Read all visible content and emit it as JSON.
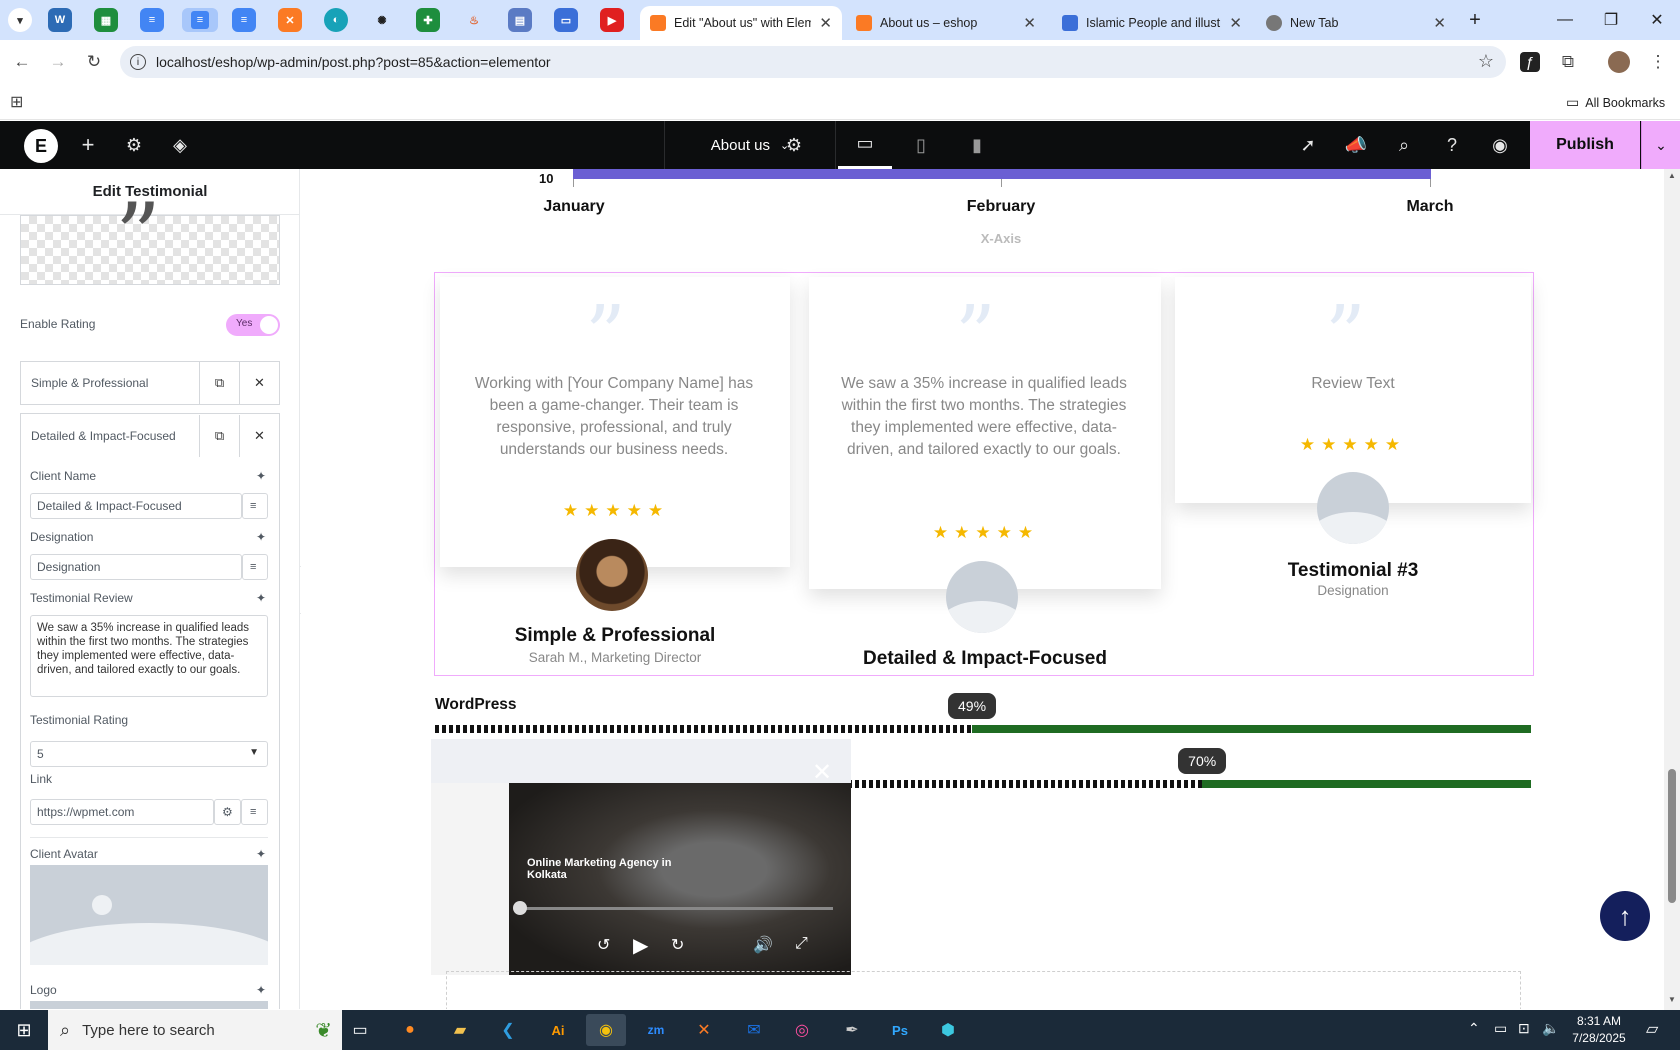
{
  "browser": {
    "pinned_tabs": [
      "WordPress",
      "Sheets",
      "Docs",
      "Docs",
      "Docs",
      "XAMPP",
      "Site",
      "ChatGPT",
      "Sheets",
      "App",
      "Tool",
      "Forms",
      "YouTube"
    ],
    "tabs": [
      {
        "title": "Edit \"About us\" with Elem",
        "active": true
      },
      {
        "title": "About us – eshop",
        "active": false
      },
      {
        "title": "Islamic People and illustr",
        "active": false
      },
      {
        "title": "New Tab",
        "active": false
      }
    ],
    "url": "localhost/eshop/wp-admin/post.php?post=85&action=elementor",
    "all_bookmarks": "All Bookmarks"
  },
  "elementor": {
    "page_name": "About us",
    "publish": "Publish"
  },
  "panel": {
    "title": "Edit Testimonial",
    "enable_rating_label": "Enable Rating",
    "enable_rating_value": "Yes",
    "items": [
      {
        "label": "Simple & Professional"
      },
      {
        "label": "Detailed & Impact-Focused"
      }
    ],
    "client_name_label": "Client Name",
    "client_name_value": "Detailed & Impact-Focused",
    "designation_label": "Designation",
    "designation_value": "Designation",
    "review_label": "Testimonial Review",
    "review_value": "We saw a 35% increase in qualified leads within the first two months. The strategies they implemented were effective, data-driven, and tailored exactly to our goals.",
    "rating_label": "Testimonial Rating",
    "rating_value": "5",
    "link_label": "Link",
    "link_value": "https://wpmet.com",
    "avatar_label": "Client Avatar",
    "logo_label": "Logo"
  },
  "chart": {
    "tick_value": "10",
    "months": [
      "January",
      "February",
      "March"
    ],
    "x_axis_label": "X-Axis"
  },
  "testimonials": [
    {
      "review": "Working with [Your Company Name] has been a game-changer. Their team is responsive, professional, and truly understands our business needs.",
      "stars": "★★★★★",
      "name": "Simple & Professional",
      "designation": "Sarah M., Marketing Director"
    },
    {
      "review": "We saw a 35% increase in qualified leads within the first two months. The strategies they implemented were effective, data-driven, and tailored exactly to our goals.",
      "stars": "★★★★★",
      "name": "Detailed & Impact-Focused",
      "designation": ""
    },
    {
      "review": "Review Text",
      "stars": "★★★★★",
      "name": "Testimonial #3",
      "designation": "Designation"
    }
  ],
  "progress": {
    "title": "WordPress",
    "bars": [
      {
        "percent": 49,
        "label": "49%"
      },
      {
        "percent": 70,
        "label": "70%"
      }
    ]
  },
  "video": {
    "caption": "Online Marketing Agency in Kolkata"
  },
  "taskbar": {
    "search_placeholder": "Type here to search",
    "time": "8:31 AM",
    "date": "7/28/2025"
  },
  "colors": {
    "accent": "#f0abfc",
    "progress_fill": "#1f6b22",
    "chart_bar": "#6b5fd3",
    "stars": "#f5b800"
  }
}
